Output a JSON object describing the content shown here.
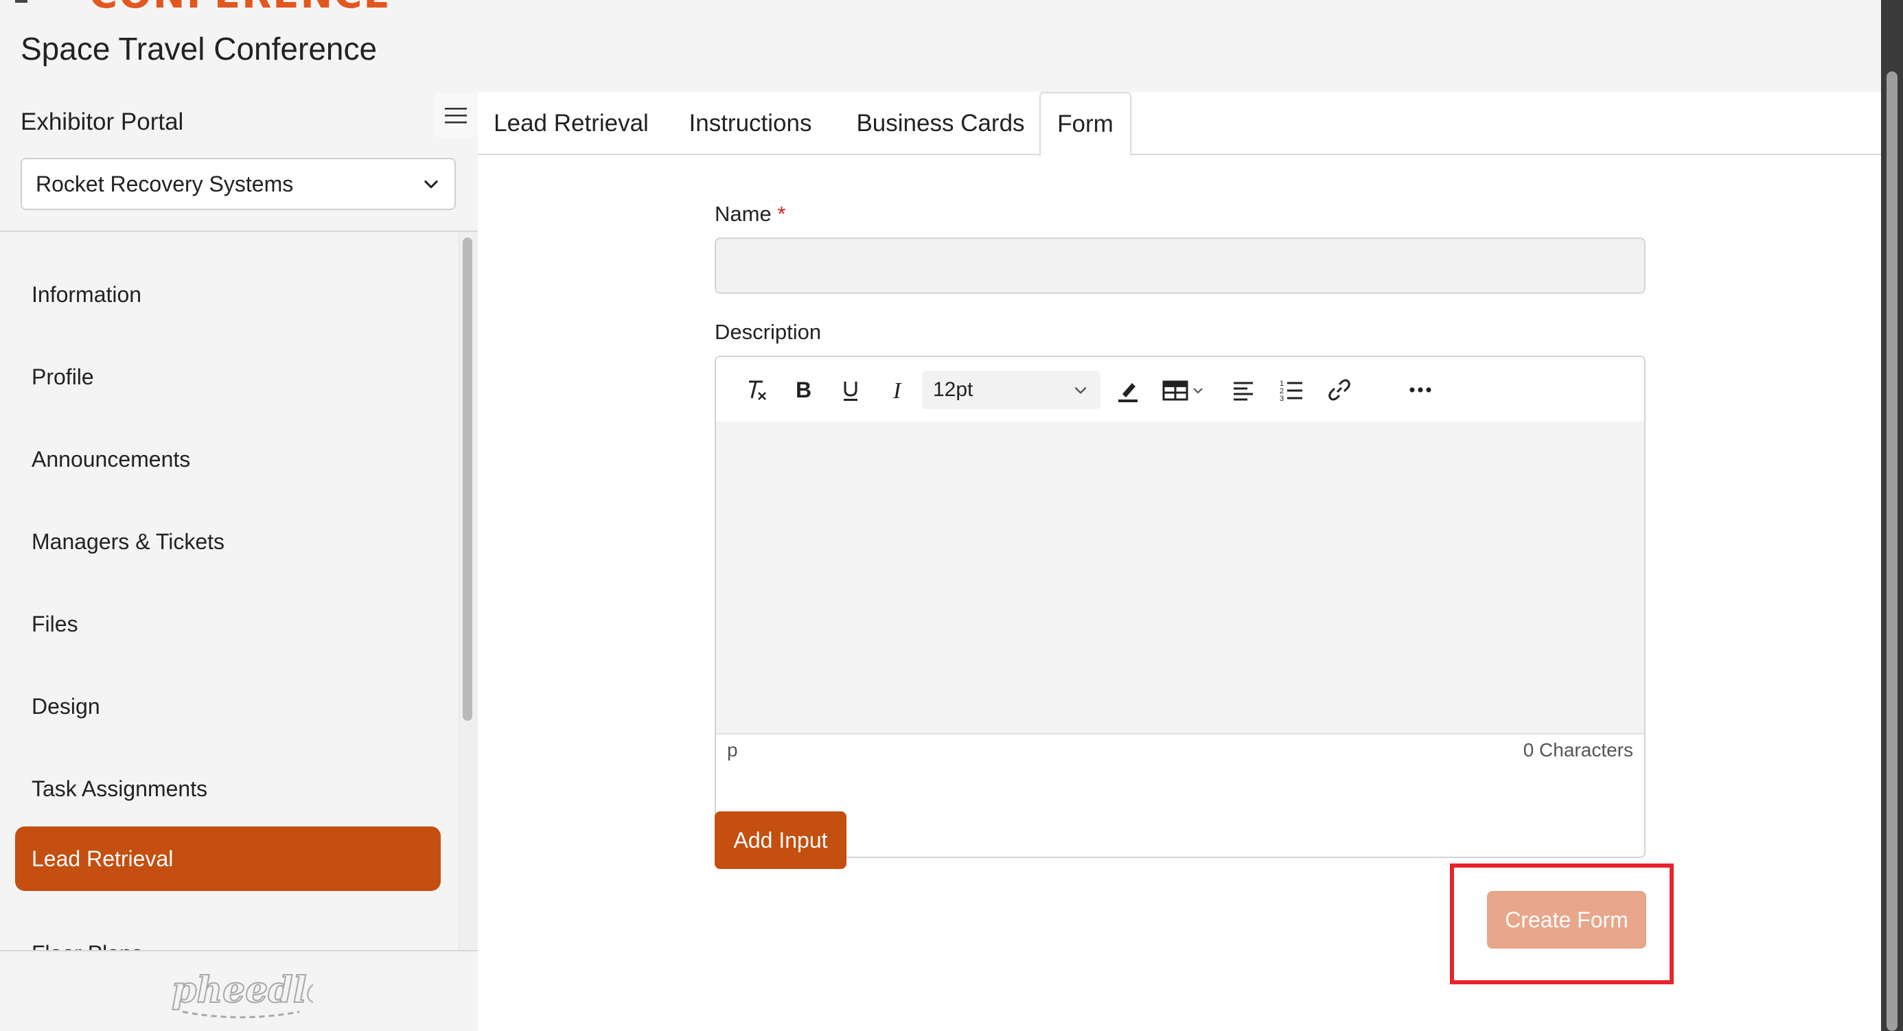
{
  "app": {
    "conference_title": "Space Travel Conference",
    "logo_partial_text": "CONFERENCE"
  },
  "sidebar": {
    "portal_label": "Exhibitor Portal",
    "exhibitor_select": {
      "value": "Rocket Recovery Systems"
    },
    "items": [
      {
        "label": "Information",
        "active": false
      },
      {
        "label": "Profile",
        "active": false
      },
      {
        "label": "Announcements",
        "active": false
      },
      {
        "label": "Managers & Tickets",
        "active": false
      },
      {
        "label": "Files",
        "active": false
      },
      {
        "label": "Design",
        "active": false
      },
      {
        "label": "Task Assignments",
        "active": false
      },
      {
        "label": "Lead Retrieval",
        "active": true
      },
      {
        "label": "Floor Plans",
        "active": false
      }
    ],
    "brand_logo_text": "pheedloop"
  },
  "tabs": [
    {
      "label": "Lead Retrieval",
      "active": false
    },
    {
      "label": "Instructions",
      "active": false
    },
    {
      "label": "Business Cards",
      "active": false
    },
    {
      "label": "Form",
      "active": true
    }
  ],
  "form": {
    "name_label": "Name",
    "required_marker": "*",
    "name_value": "",
    "description_label": "Description",
    "editor": {
      "font_size": "12pt",
      "status_path": "p",
      "char_count": "0 Characters",
      "toolbar_icons": [
        "clear-format-icon",
        "bold-icon",
        "underline-icon",
        "italic-icon",
        "highlight-pen-icon",
        "table-icon",
        "align-left-icon",
        "numbered-list-icon",
        "link-icon",
        "more-icon"
      ]
    },
    "add_input_label": "Add Input",
    "create_form_label": "Create Form"
  },
  "colors": {
    "accent": "#c44f10",
    "accent_disabled": "#e8a68a",
    "highlight": "#e8232c",
    "logo_orange": "#e2571f"
  }
}
